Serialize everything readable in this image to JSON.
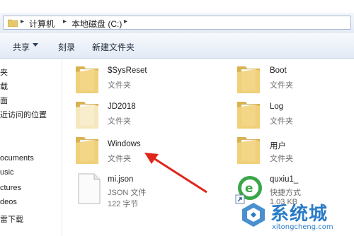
{
  "address": {
    "crumbs": [
      "计算机",
      "本地磁盘 (C:)"
    ]
  },
  "toolbar": {
    "share_label": "共享",
    "burn_label": "刻录",
    "new_folder_label": "新建文件夹"
  },
  "nav": {
    "items": [
      "收藏夹",
      "下载",
      "桌面",
      "最近访问的位置",
      "Documents",
      "Music",
      "Pictures",
      "Videos",
      "迅雷下载"
    ],
    "visible_items": [
      "夹",
      "载",
      "面",
      "近访问的位置",
      "ocuments",
      "usic",
      "ctures",
      "deos",
      "雷下载"
    ]
  },
  "files": [
    {
      "name": "$SysReset",
      "type": "文件夹",
      "icon": "folder-icon"
    },
    {
      "name": "Boot",
      "type": "文件夹",
      "icon": "folder-icon"
    },
    {
      "name": "JD2018",
      "type": "文件夹",
      "icon": "folder-icon"
    },
    {
      "name": "Log",
      "type": "文件夹",
      "icon": "folder-icon"
    },
    {
      "name": "Windows",
      "type": "文件夹",
      "icon": "folder-icon"
    },
    {
      "name": "用户",
      "type": "文件夹",
      "icon": "folder-icon"
    },
    {
      "name": "mi.json",
      "type": "JSON 文件",
      "size": "122 字节",
      "icon": "file-icon"
    },
    {
      "name": "quxiu1_",
      "type": "快捷方式",
      "size": "1.03 KB",
      "icon": "shortcut-icon"
    }
  ],
  "annotation": {
    "color": "#e0261b",
    "points_to": "Windows"
  },
  "watermark": {
    "text": "系统城",
    "url": "xitongcheng.com"
  },
  "colors": {
    "folder": "#f2d37d",
    "folder_dark": "#d9b14e",
    "brand_blue": "#2a7cc7",
    "shortcut_green": "#3aa64a"
  }
}
